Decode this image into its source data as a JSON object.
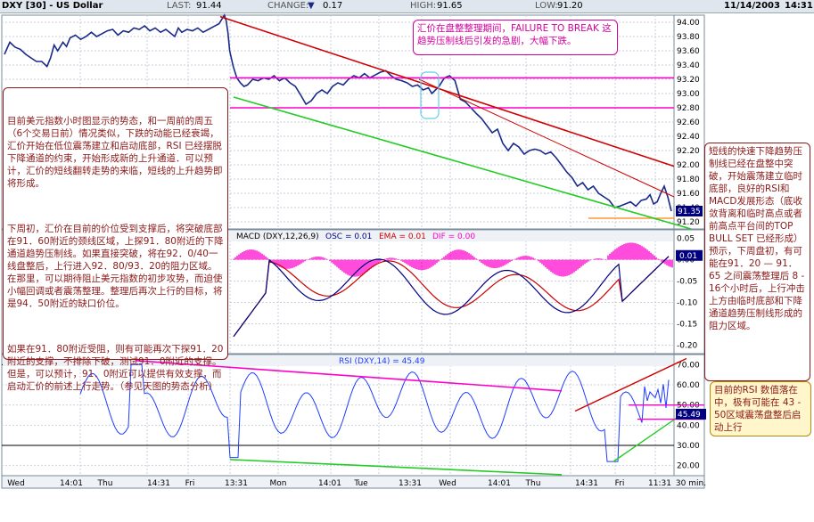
{
  "header": {
    "symbol": "DXY [30] - US Dollar",
    "last_label": "LAST:",
    "last": "91.44",
    "change_label": "CHANGE:",
    "change_arrow": "▼",
    "change": "0.17",
    "high_label": "HIGH:",
    "high": "91.65",
    "low_label": "LOW:",
    "low": "91.20",
    "date": "11/14/2003",
    "time": "14:31"
  },
  "chart_data": [
    {
      "type": "line",
      "panel": "price",
      "y_ticks": [
        "94.00",
        "93.80",
        "93.60",
        "93.40",
        "93.20",
        "93.00",
        "92.80",
        "92.60",
        "92.40",
        "92.20",
        "92.00",
        "91.80",
        "91.60",
        "91.40",
        "91.20"
      ],
      "ylim": [
        91.1,
        94.1
      ],
      "last_value_label": "91.35",
      "x": [
        0,
        6,
        12,
        18,
        24,
        30,
        36,
        42,
        48,
        52,
        56,
        60,
        66,
        70,
        74,
        80,
        86,
        92,
        98,
        104,
        110,
        116,
        122,
        128,
        134,
        140,
        146,
        152,
        158,
        164,
        170,
        176,
        182,
        188,
        192,
        196,
        200,
        206,
        212,
        218,
        224,
        230,
        236,
        242,
        248,
        250,
        252,
        254,
        258,
        262,
        266,
        270,
        274,
        280,
        286,
        292,
        298,
        304,
        310,
        316,
        322,
        328,
        334,
        340,
        346,
        352,
        358,
        364,
        370,
        376,
        382,
        388,
        394,
        400,
        406,
        412,
        418,
        424,
        430,
        436,
        442,
        448,
        454,
        460,
        466,
        472,
        478,
        482,
        486,
        490,
        496,
        502,
        508,
        514,
        520,
        526,
        532,
        538,
        544,
        550,
        556,
        562,
        568,
        574,
        580,
        586,
        592,
        598,
        604,
        610,
        616,
        622,
        628,
        634,
        640,
        646,
        652,
        658,
        664,
        670,
        676,
        682,
        688,
        694,
        700,
        706,
        712,
        718,
        724,
        728,
        732,
        736,
        740,
        744,
        748,
        752
      ],
      "series": [
        {
          "values": [
            93.55,
            93.72,
            93.65,
            93.62,
            93.55,
            93.5,
            93.45,
            93.45,
            93.38,
            93.5,
            93.68,
            93.6,
            93.72,
            93.66,
            93.78,
            93.82,
            93.76,
            93.8,
            93.86,
            93.8,
            93.84,
            93.88,
            93.9,
            93.82,
            93.88,
            93.86,
            93.92,
            93.9,
            93.95,
            93.88,
            93.92,
            93.86,
            93.9,
            93.84,
            93.8,
            93.92,
            93.86,
            93.9,
            93.88,
            93.92,
            93.86,
            93.9,
            93.94,
            93.98,
            94.1,
            94.02,
            93.85,
            93.6,
            93.38,
            93.22,
            93.15,
            93.1,
            93.12,
            93.2,
            93.18,
            93.22,
            93.2,
            93.25,
            93.18,
            93.22,
            93.15,
            93.1,
            92.98,
            92.85,
            92.9,
            93.0,
            93.05,
            93.0,
            93.1,
            93.15,
            93.12,
            93.2,
            93.25,
            93.22,
            93.28,
            93.22,
            93.26,
            93.3,
            93.32,
            93.25,
            93.2,
            93.18,
            93.15,
            93.1,
            93.12,
            93.05,
            93.08,
            93.0,
            93.05,
            93.1,
            93.22,
            93.25,
            93.18,
            92.92,
            92.88,
            92.8,
            92.72,
            92.65,
            92.55,
            92.45,
            92.5,
            92.3,
            92.2,
            92.3,
            92.25,
            92.15,
            92.2,
            92.22,
            92.2,
            92.15,
            92.18,
            92.1,
            92.0,
            91.9,
            91.82,
            91.7,
            91.75,
            91.65,
            91.7,
            91.6,
            91.55,
            91.5,
            91.4,
            91.42,
            91.45,
            91.48,
            91.42,
            91.5,
            91.52,
            91.58,
            91.45,
            91.48,
            91.6,
            91.7,
            91.55,
            91.35
          ]
        }
      ]
    },
    {
      "type": "line",
      "panel": "macd",
      "title": "MACD (DXY,12,26,9)",
      "osc_label": "OSC = 0.01",
      "ema_label": "EMA = 0.01",
      "dif_label": "DIF = 0.00",
      "y_ticks": [
        "0.05",
        "0.00",
        "-0.05",
        "-0.10",
        "-0.15",
        "-0.20"
      ],
      "ylim": [
        -0.22,
        0.07
      ],
      "last_value_label": "0.01"
    },
    {
      "type": "line",
      "panel": "rsi",
      "title": "RSI (DXY,14) = 45.49",
      "y_ticks": [
        "70.00",
        "60.00",
        "50.00",
        "40.00",
        "30.00",
        "20.00"
      ],
      "ylim": [
        15,
        75
      ],
      "last_value_label": "45.49",
      "x_ticks": [
        "Wed",
        "14:01",
        "Thu",
        "14:31",
        "Fri",
        "13:31",
        "Mon",
        "14:01",
        "Tue",
        "13:31",
        "Wed",
        "14:01",
        "Thu",
        "14:31",
        "Fri",
        "11:31",
        "30 min."
      ]
    }
  ],
  "annotations": {
    "top": "汇价在盘整整理期间，FAILURE TO BREAK 这趋势压制线后引发的急剧，大幅下跌。",
    "left_p1": "目前美元指数小时图显示的势态，和一周前的周五（6个交易日前）情况类似，下跌的动能已经衰竭，汇价开始在低位震荡建立和启动底部，RSI 已经摆脱下降通道的约束，开始形成新的上升通道．可以预计，汇价的短线翻转走势的来临，短线的上升趋势即将形成。",
    "left_p2": "下周初，汇价在目前的价位受到支撑后，将突破底部在91．60附近的颈线区域，上探91．80附近的下降通道趋势压制线。如果直接突破，将在92．0/40一线盘整后，上行进入92．80/93．20的阻力区域。在那里，可以期待阻止美元指数的初步攻势，而迫使小幅回调或者震荡整理。整理后再次上行的目标，将是94．50附近的缺口价位。",
    "left_p3": "如果在91．80附近受阻，则有可能再次下探91．20附近的支撑，不排除下破，测试91．0附近的支撑。但是，可以预计，91．0附近可以提供有效支撑，而启动汇价的前述上行走势。（参见天图的势态分析）",
    "right": "短线的快速下降趋势压制线已经在盘整中突破，开始震荡建立临时底部，良好的RSI和MACD发展形态（底收敛背离和临时高点或者前高点平台间的TOP BULL SET 已经形成）预示，下周盘初，有可能在91．20 — 91．65 之间震荡整理后 8 - 16个小时后，上行冲击上方由临时底部和下降通道趋势压制线形成的阻力区域。",
    "rsi": "目前的RSI 数值落在中，极有可能在 43 - 50区域震荡盘整后启动上行"
  },
  "colors": {
    "price_line": "#1a2a8a",
    "down_trend": "#d00000",
    "support_trend": "#22cc22",
    "resistance_h": "#ff00cc",
    "histogram": "#ff00cc",
    "macd_red": "#cc0000",
    "macd_blue": "#000080",
    "rsi_line": "#1e3cff"
  }
}
